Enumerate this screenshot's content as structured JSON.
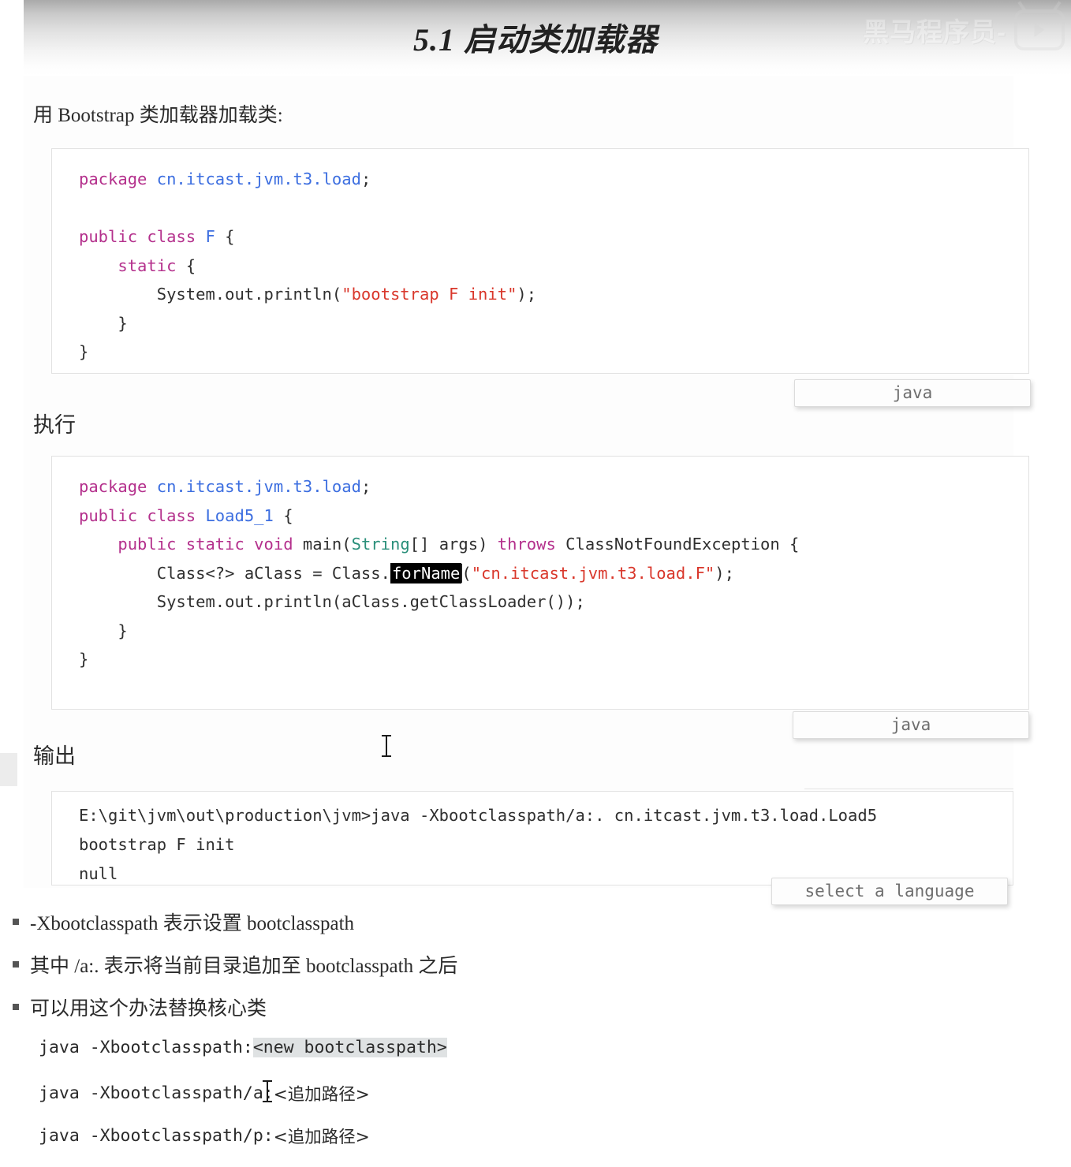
{
  "page": {
    "title": "5.1 启动类加载器",
    "watermark_text": "黑马程序员-",
    "watermark_logo": "bilibili-logo-icon"
  },
  "intro": {
    "line": "用 Bootstrap 类加载器加载类:"
  },
  "sections": {
    "exec_heading": "执行",
    "output_heading": "输出"
  },
  "code_block_1": {
    "language_label": "java",
    "lines": [
      {
        "tokens": [
          {
            "t": "package",
            "c": "kw"
          },
          {
            "t": " ",
            "c": "plain"
          },
          {
            "t": "cn.itcast.jvm.t3.load",
            "c": "pkg"
          },
          {
            "t": ";",
            "c": "plain"
          }
        ]
      },
      {
        "tokens": []
      },
      {
        "tokens": [
          {
            "t": "public class",
            "c": "kw"
          },
          {
            "t": " ",
            "c": "plain"
          },
          {
            "t": "F",
            "c": "pkg"
          },
          {
            "t": " {",
            "c": "plain"
          }
        ]
      },
      {
        "tokens": [
          {
            "t": "    ",
            "c": "plain"
          },
          {
            "t": "static",
            "c": "kw"
          },
          {
            "t": " {",
            "c": "plain"
          }
        ]
      },
      {
        "tokens": [
          {
            "t": "        System.out.println(",
            "c": "plain"
          },
          {
            "t": "\"bootstrap F init\"",
            "c": "str"
          },
          {
            "t": ");",
            "c": "plain"
          }
        ]
      },
      {
        "tokens": [
          {
            "t": "    }",
            "c": "plain"
          }
        ]
      },
      {
        "tokens": [
          {
            "t": "}",
            "c": "plain"
          }
        ]
      }
    ],
    "raw": "package cn.itcast.jvm.t3.load;\n\npublic class F {\n    static {\n        System.out.println(\"bootstrap F init\");\n    }\n}"
  },
  "code_block_2": {
    "language_label": "java",
    "selected_token": "forName",
    "raw": "package cn.itcast.jvm.t3.load;\npublic class Load5_1 {\n    public static void main(String[] args) throws ClassNotFoundException {\n        Class<?> aClass = Class.forName(\"cn.itcast.jvm.t3.load.F\");\n        System.out.println(aClass.getClassLoader());\n    }\n}"
  },
  "output_block": {
    "language_label": "select a language",
    "lines": [
      "E:\\git\\jvm\\out\\production\\jvm>java -Xbootclasspath/a:. cn.itcast.jvm.t3.load.Load5",
      "bootstrap F init",
      "null"
    ]
  },
  "bullets": [
    {
      "text": "-Xbootclasspath 表示设置 bootclasspath"
    },
    {
      "text": "其中 /a:. 表示将当前目录追加至 bootclasspath 之后"
    },
    {
      "text": "可以用这个办法替换核心类"
    }
  ],
  "sub_bullets": [
    {
      "prefix": "java -Xbootclasspath:",
      "highlighted": "<new bootclasspath>",
      "suffix": ""
    },
    {
      "prefix": "java -Xbootclasspath/a:",
      "highlighted": "",
      "suffix": "<追加路径>"
    },
    {
      "prefix": "java -Xbootclasspath/p:",
      "highlighted": "",
      "suffix": "<追加路径>"
    }
  ],
  "colors": {
    "keyword": "#b4308c",
    "package": "#3c6ee0",
    "string": "#d9372b",
    "type": "#2a8f7a",
    "selection_bg": "#000000",
    "highlight_gray": "#dfe2e3"
  }
}
